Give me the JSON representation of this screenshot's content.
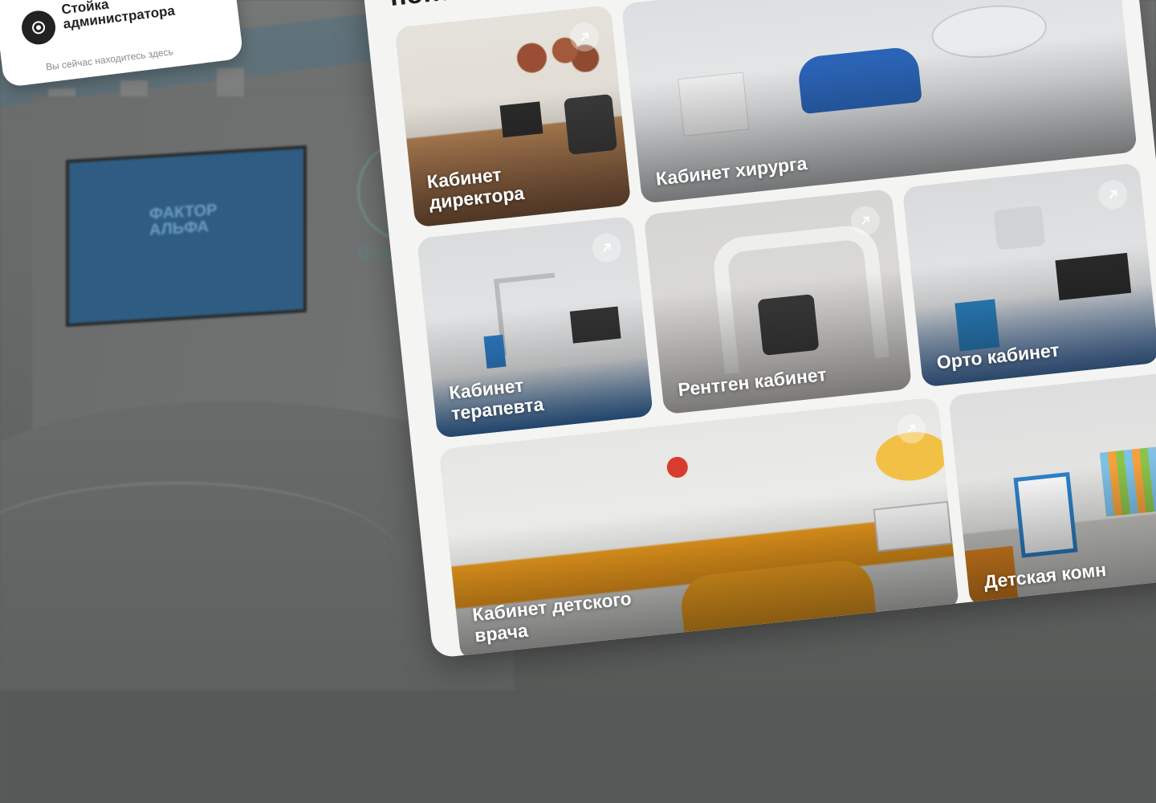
{
  "admin_card": {
    "title": "Стойка администратора",
    "subtitle": "Вы сейчас находитесь здесь",
    "icon": "location-target-icon"
  },
  "background": {
    "screen_text": "ФАКТОР АЛЬФА",
    "logo_text": "ФАКТ АЛЬ"
  },
  "panel": {
    "title": "попас"
  },
  "rooms": [
    {
      "label": "Кабинет директора",
      "arrow_icon": "open-arrow-icon"
    },
    {
      "label": "Кабинет хирурга",
      "arrow_icon": "open-arrow-icon"
    },
    {
      "label": "Кабинет терапевта",
      "arrow_icon": "open-arrow-icon"
    },
    {
      "label": "Рентген кабинет",
      "arrow_icon": "open-arrow-icon"
    },
    {
      "label": "Орто кабинет",
      "arrow_icon": "open-arrow-icon"
    },
    {
      "label": "Кабинет детского врача",
      "arrow_icon": "open-arrow-icon"
    },
    {
      "label": "Детская комн",
      "arrow_icon": "open-arrow-icon"
    }
  ]
}
